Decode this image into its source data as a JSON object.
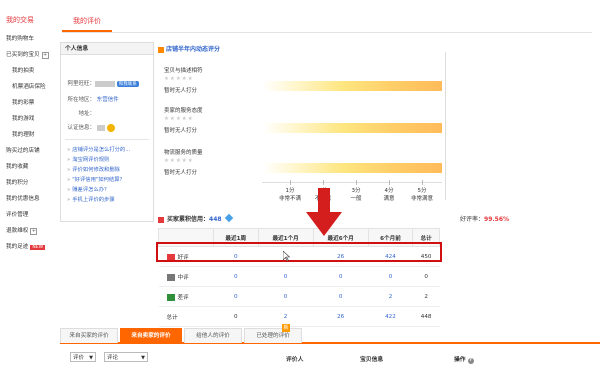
{
  "sidebar": {
    "title": "我的交易",
    "items": [
      {
        "label": "我的购物车",
        "sub": false
      },
      {
        "label": "已买到的宝贝",
        "sub": false,
        "plus": true
      },
      {
        "label": "我的拍卖",
        "sub": true
      },
      {
        "label": "机票酒店保险",
        "sub": true
      },
      {
        "label": "我的彩票",
        "sub": true
      },
      {
        "label": "我的游戏",
        "sub": true
      },
      {
        "label": "我的理财",
        "sub": true
      },
      {
        "label": "购买过的店铺",
        "sub": false
      },
      {
        "label": "我的收藏",
        "sub": false
      },
      {
        "label": "我的积分",
        "sub": false
      },
      {
        "label": "我的优惠信息",
        "sub": false
      },
      {
        "label": "评价管理",
        "sub": false
      },
      {
        "label": "退款维权",
        "sub": false,
        "plus": true
      },
      {
        "label": "我的足迹",
        "sub": false,
        "badge": "NEW"
      }
    ]
  },
  "top_tab": "我的评价",
  "personal_info": {
    "title": "个人信息",
    "wangwang_label": "阿里旺旺：",
    "wangwang_status": "和我联系",
    "location_label": "所在地区：",
    "location_value": "东营信件",
    "address_label": "地址：",
    "auth_label": "认证信息：",
    "links": [
      "店铺评分是怎么打分的...",
      "淘宝网评价规则",
      "评价如何修改和删除",
      "\"好评信用\"如何结算？",
      "赚差评怎么办？",
      "手机上评价的步骤"
    ]
  },
  "dynamic_ratings": {
    "title": "店铺半年内动态评分",
    "metrics": [
      {
        "name": "宝贝与描述相符",
        "stars": "★★★★★",
        "status": "暂时无人打分"
      },
      {
        "name": "卖家的服务态度",
        "stars": "★★★★★",
        "status": "暂时无人打分"
      },
      {
        "name": "物流服务的质量",
        "stars": "★★★★★",
        "status": "暂时无人打分"
      }
    ],
    "scale": [
      {
        "score": "1分",
        "label": "非常不满"
      },
      {
        "score": "2分",
        "label": "不满意"
      },
      {
        "score": "3分",
        "label": "一般"
      },
      {
        "score": "4分",
        "label": "满意"
      },
      {
        "score": "5分",
        "label": "非常满意"
      }
    ]
  },
  "credit": {
    "label": "买家累积信用：",
    "score": "448",
    "positive_label": "好评率：",
    "positive_rate": "99.56%",
    "columns": [
      "",
      "最近1周",
      "最近1个月",
      "最近6个月",
      "6个月前",
      "总计"
    ],
    "rows": [
      {
        "label": "好评",
        "icon": "good",
        "values": [
          "0",
          "2",
          "26",
          "424",
          "450"
        ]
      },
      {
        "label": "中评",
        "icon": "mid",
        "values": [
          "0",
          "0",
          "0",
          "0",
          "0"
        ]
      },
      {
        "label": "差评",
        "icon": "bad",
        "values": [
          "0",
          "0",
          "0",
          "2",
          "2"
        ]
      },
      {
        "label": "总计",
        "icon": null,
        "values": [
          "0",
          "2",
          "26",
          "422",
          "448"
        ]
      }
    ]
  },
  "bottom_tabs": [
    {
      "label": "来自买家的评价",
      "active": false
    },
    {
      "label": "来自卖家的评价",
      "active": true
    },
    {
      "label": "给他人的评价",
      "active": false
    },
    {
      "label": "已处理的评价",
      "active": false
    }
  ],
  "filters": {
    "select1": "评价",
    "select2": "评论",
    "col_reviewer": "评价人",
    "col_item": "宝贝信息",
    "col_action": "操作"
  },
  "colors": {
    "accent": "#ff6600",
    "highlight": "#d01010",
    "link": "#3366cc"
  }
}
